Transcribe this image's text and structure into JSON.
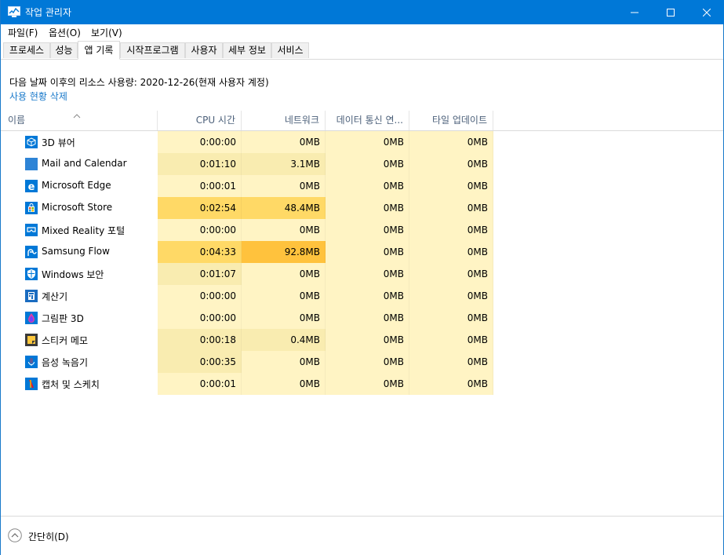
{
  "window": {
    "title": "작업 관리자"
  },
  "menu": [
    "파일(F)",
    "옵션(O)",
    "보기(V)"
  ],
  "tabs": [
    "프로세스",
    "성능",
    "앱 기록",
    "시작프로그램",
    "사용자",
    "세부 정보",
    "서비스"
  ],
  "active_tab": "앱 기록",
  "info": {
    "usage_since": "다음 날짜 이후의 리소스 사용량: 2020-12-26(현재 사용자 계정)",
    "delete_link": "사용 현황 삭제"
  },
  "columns": {
    "name": "이름",
    "cpu": "CPU 시간",
    "network": "네트워크",
    "metered": "데이터 통신 연...",
    "tile": "타일 업데이트"
  },
  "rows": [
    {
      "name": "3D 뷰어",
      "icon": "cube-icon",
      "cpu": "0:00:00",
      "network": "0MB",
      "metered": "0MB",
      "tile": "0MB"
    },
    {
      "name": "Mail and Calendar",
      "icon": "mail-calendar-icon",
      "cpu": "0:01:10",
      "network": "3.1MB",
      "metered": "0MB",
      "tile": "0MB"
    },
    {
      "name": "Microsoft Edge",
      "icon": "edge-icon",
      "cpu": "0:00:01",
      "network": "0MB",
      "metered": "0MB",
      "tile": "0MB"
    },
    {
      "name": "Microsoft Store",
      "icon": "store-icon",
      "cpu": "0:02:54",
      "network": "48.4MB",
      "metered": "0MB",
      "tile": "0MB"
    },
    {
      "name": "Mixed Reality 포털",
      "icon": "mixed-reality-icon",
      "cpu": "0:00:00",
      "network": "0MB",
      "metered": "0MB",
      "tile": "0MB"
    },
    {
      "name": "Samsung Flow",
      "icon": "samsung-flow-icon",
      "cpu": "0:04:33",
      "network": "92.8MB",
      "metered": "0MB",
      "tile": "0MB"
    },
    {
      "name": "Windows 보안",
      "icon": "shield-icon",
      "cpu": "0:01:07",
      "network": "0MB",
      "metered": "0MB",
      "tile": "0MB"
    },
    {
      "name": "계산기",
      "icon": "calculator-icon",
      "cpu": "0:00:00",
      "network": "0MB",
      "metered": "0MB",
      "tile": "0MB"
    },
    {
      "name": "그림판 3D",
      "icon": "paint3d-icon",
      "cpu": "0:00:00",
      "network": "0MB",
      "metered": "0MB",
      "tile": "0MB"
    },
    {
      "name": "스티커 메모",
      "icon": "sticky-notes-icon",
      "cpu": "0:00:18",
      "network": "0.4MB",
      "metered": "0MB",
      "tile": "0MB"
    },
    {
      "name": "음성 녹음기",
      "icon": "voice-recorder-icon",
      "cpu": "0:00:35",
      "network": "0MB",
      "metered": "0MB",
      "tile": "0MB"
    },
    {
      "name": "캡처 및 스케치",
      "icon": "snip-sketch-icon",
      "cpu": "0:00:01",
      "network": "0MB",
      "metered": "0MB",
      "tile": "0MB"
    }
  ],
  "heat_colors": {
    "lowest": "#fff4c4",
    "low": "#f9ecb0",
    "medium": "#ffd966",
    "high": "#ffc23d"
  },
  "bottom": {
    "collapse_label": "간단히(D)"
  }
}
